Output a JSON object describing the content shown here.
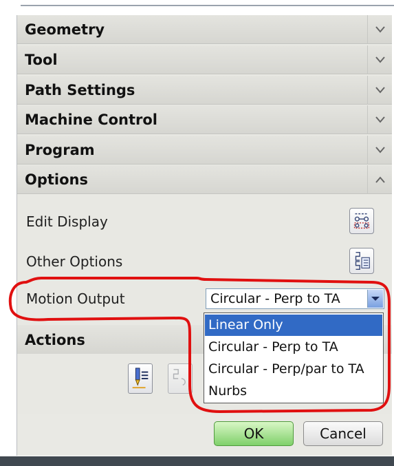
{
  "groups": [
    {
      "label": "Geometry",
      "chevron": "chevron-down-icon"
    },
    {
      "label": "Tool",
      "chevron": "chevron-down-icon"
    },
    {
      "label": "Path Settings",
      "chevron": "chevron-down-icon"
    },
    {
      "label": "Machine Control",
      "chevron": "chevron-down-icon"
    },
    {
      "label": "Program",
      "chevron": "chevron-down-icon"
    },
    {
      "label": "Options",
      "chevron": "chevron-up-icon"
    }
  ],
  "options": {
    "edit_display_label": "Edit Display",
    "other_options_label": "Other Options",
    "motion_output_label": "Motion Output",
    "motion_output_value": "Circular - Perp to TA"
  },
  "dropdown": {
    "items": [
      "Linear Only",
      "Circular - Perp to TA",
      "Circular - Perp/par to TA",
      "Nurbs"
    ],
    "highlighted_index": 0
  },
  "actions": {
    "label": "Actions"
  },
  "footer": {
    "ok_label": "OK",
    "cancel_label": "Cancel"
  },
  "colors": {
    "highlight": "#316ac5",
    "annotation": "#e01010",
    "ok_green": "#7fd06a"
  }
}
